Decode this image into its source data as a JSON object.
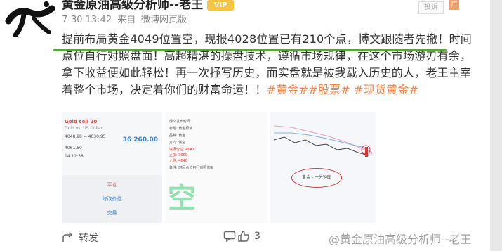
{
  "author": {
    "name": "黄金原油高级分析师--老王",
    "vip_label": "VIP"
  },
  "meta": {
    "time": "7-30 13:42",
    "source_prefix": "来自",
    "source": "微博网页版"
  },
  "report_label": "投诉",
  "ad_label": "广",
  "post": {
    "line1": "提前布局黄金4049位置空，现报4028位置已有210个点，博文跟随者先撤！时间",
    "line2": "点位自行对照盘面！高超精湛的操盘技术，遵循市场规律，在这个市场游刃有余，",
    "line3": "拿下收益便如此轻松！再一次抒写历史，而实盘就是被我载入历史的人，老王主宰",
    "line4_text": "着整个市场，决定着你们的财富命运！！",
    "tags": "#黄金##股票# #现货黄金#"
  },
  "images": {
    "img1": {
      "title": "Gold sell 20",
      "subtitle": "Gold vs. US Dollar",
      "range": "4048.98 → 4030.95",
      "price": "36 260.00",
      "rows": [
        "4061.60",
        "14 12:38"
      ],
      "buttons": [
        "平仓",
        "修改价位",
        "交易"
      ]
    },
    "img2": {
      "lines": [
        "博文发布时间:",
        "标题: 黄金原油",
        "品种: 黄金",
        "方向: 做空",
        "进场价位: 4047",
        "止损: 3960",
        "止盈: 4040",
        "备注: 时间点位自行对照盘面"
      ],
      "big_char": "空"
    },
    "img3": {
      "ellipse_label": "黄金 - 一分钟图"
    }
  },
  "actions": {
    "share": "转发",
    "comment": "",
    "like": "3"
  },
  "watermark": "@黄金原油高级分析师--老王"
}
